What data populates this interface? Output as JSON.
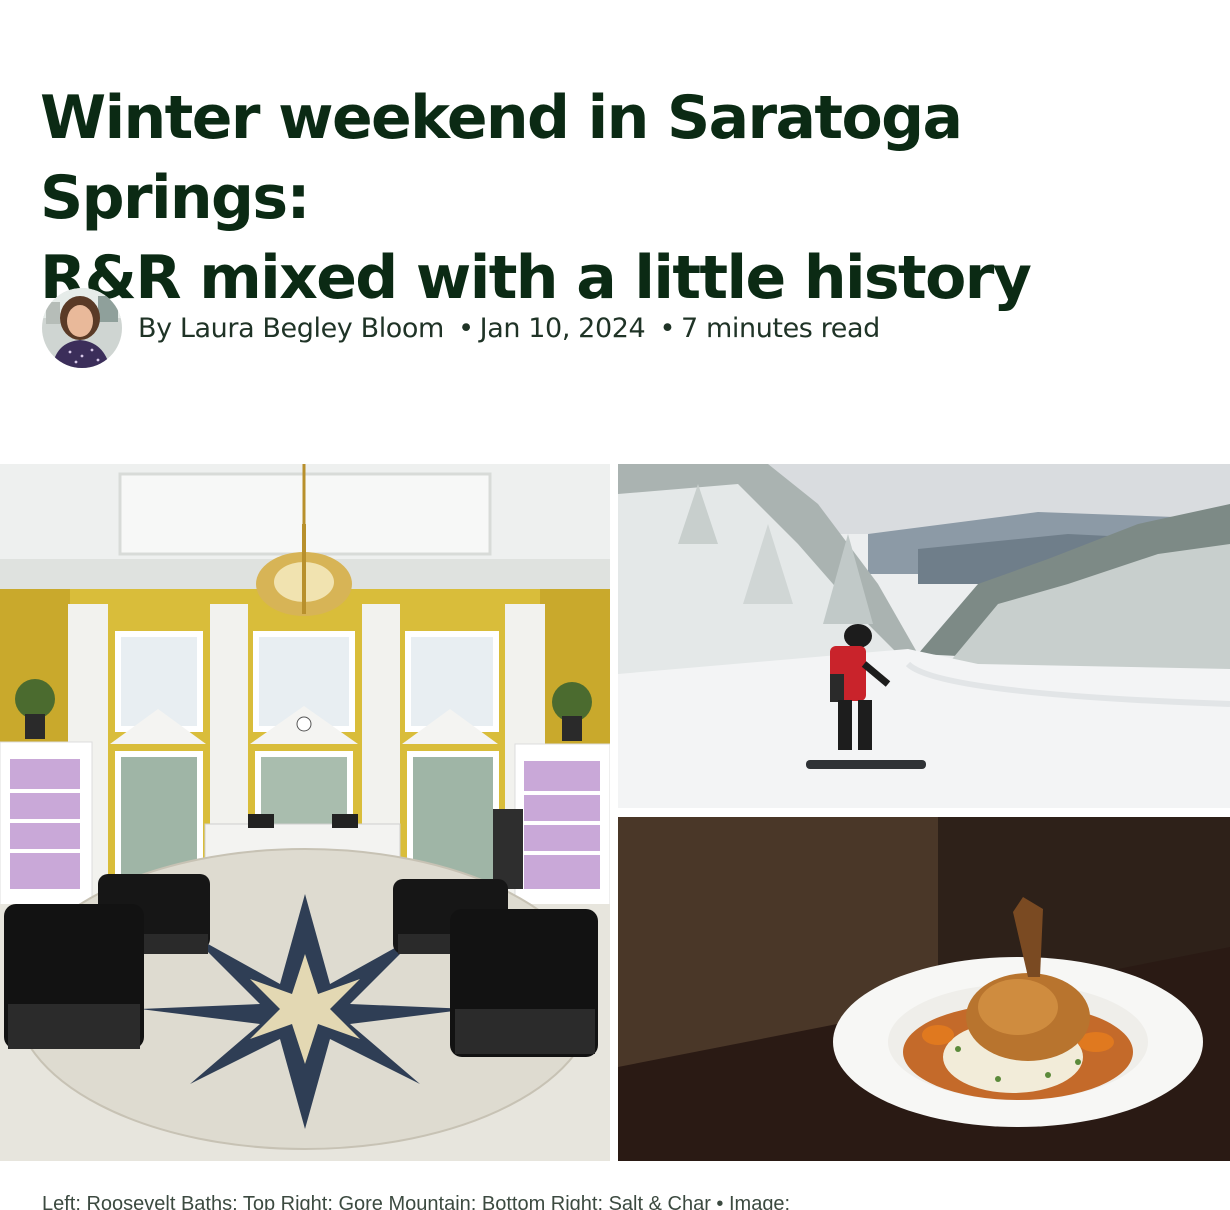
{
  "article": {
    "title_line1": "Winter weekend in Saratoga Springs:",
    "title_line2": "R&R mixed with a little history",
    "byline": {
      "prefix": "By",
      "author": "Laura Begley Bloom",
      "separator": "•",
      "date": "Jan 10, 2024",
      "read_time": "7 minutes read"
    },
    "images": {
      "left": "roosevelt-baths-lobby",
      "top_right": "gore-mountain-snowboarder",
      "bottom_right": "salt-and-char-dish"
    },
    "caption": "Left: Roosevelt Baths; Top Right: Gore Mountain; Bottom Right: Salt & Char • Image:"
  },
  "colors": {
    "headline": "#0b2a14",
    "byline": "#1f3326",
    "caption": "#3c4a40"
  }
}
